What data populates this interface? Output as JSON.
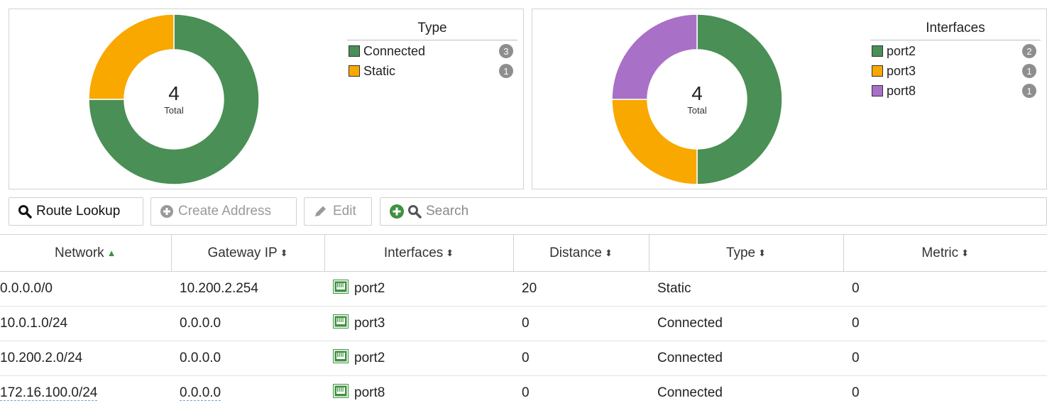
{
  "charts": {
    "type_chart": {
      "title": "Type",
      "total_value": "4",
      "total_label": "Total",
      "items": [
        {
          "label": "Connected",
          "count": "3",
          "color": "#4a8f55"
        },
        {
          "label": "Static",
          "count": "1",
          "color": "#f9a800"
        }
      ]
    },
    "interfaces_chart": {
      "title": "Interfaces",
      "total_value": "4",
      "total_label": "Total",
      "items": [
        {
          "label": "port2",
          "count": "2",
          "color": "#4a8f55"
        },
        {
          "label": "port3",
          "count": "1",
          "color": "#f9a800"
        },
        {
          "label": "port8",
          "count": "1",
          "color": "#a970c8"
        }
      ]
    }
  },
  "chart_data": [
    {
      "type": "pie",
      "title": "Type",
      "categories": [
        "Connected",
        "Static"
      ],
      "values": [
        3,
        1
      ],
      "center_text": "4 Total"
    },
    {
      "type": "pie",
      "title": "Interfaces",
      "categories": [
        "port2",
        "port3",
        "port8"
      ],
      "values": [
        2,
        1,
        1
      ],
      "center_text": "4 Total"
    }
  ],
  "toolbar": {
    "route_lookup": "Route Lookup",
    "create_address": "Create Address",
    "edit": "Edit",
    "search_placeholder": "Search"
  },
  "table": {
    "columns": [
      "Network",
      "Gateway IP",
      "Interfaces",
      "Distance",
      "Type",
      "Metric"
    ],
    "rows": [
      {
        "network": "0.0.0.0/0",
        "gateway": "10.200.2.254",
        "interface": "port2",
        "distance": "20",
        "type": "Static",
        "metric": "0"
      },
      {
        "network": "10.0.1.0/24",
        "gateway": "0.0.0.0",
        "interface": "port3",
        "distance": "0",
        "type": "Connected",
        "metric": "0"
      },
      {
        "network": "10.200.2.0/24",
        "gateway": "0.0.0.0",
        "interface": "port2",
        "distance": "0",
        "type": "Connected",
        "metric": "0"
      },
      {
        "network": "172.16.100.0/24",
        "gateway": "0.0.0.0",
        "interface": "port8",
        "distance": "0",
        "type": "Connected",
        "metric": "0"
      }
    ]
  }
}
